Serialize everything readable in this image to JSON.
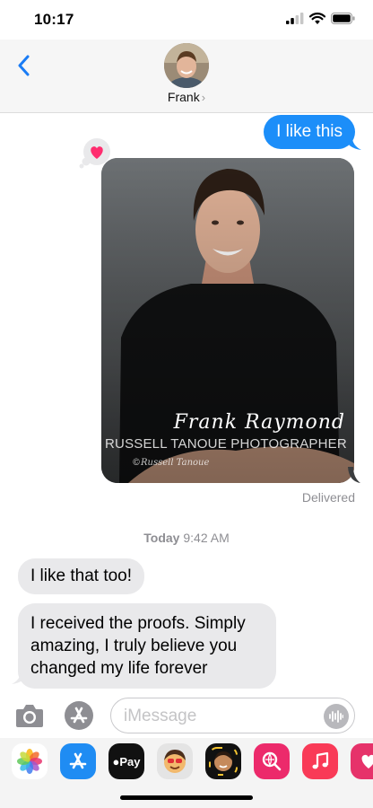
{
  "status_bar": {
    "time": "10:17"
  },
  "header": {
    "contact_name": "Frank",
    "chevron": "›"
  },
  "messages": {
    "sent_text": "I like this",
    "photo_caption": {
      "name": "Frank Raymond",
      "studio": "RUSSELL TANOUE PHOTOGRAPHER",
      "watermark": "©Russell Tanoue"
    },
    "delivered": "Delivered",
    "timestamp_day": "Today",
    "timestamp_time": "9:42 AM",
    "received": [
      "I like that too!",
      "I received the proofs. Simply amazing, I truly believe you changed my life forever"
    ]
  },
  "composer": {
    "placeholder": "iMessage"
  },
  "app_drawer": {
    "apple_pay_label": "Pay",
    "icons": [
      "photos-icon",
      "app-store-icon",
      "apple-pay-icon",
      "memoji-icon",
      "animoji-icon",
      "web-search-icon",
      "music-icon",
      "heart-sticker-icon"
    ]
  },
  "colors": {
    "sent_bubble": "#1c8ef9",
    "received_bubble": "#e9e9eb",
    "ios_blue": "#1a7cf5",
    "tapback_heart": "#ff2d6f"
  }
}
